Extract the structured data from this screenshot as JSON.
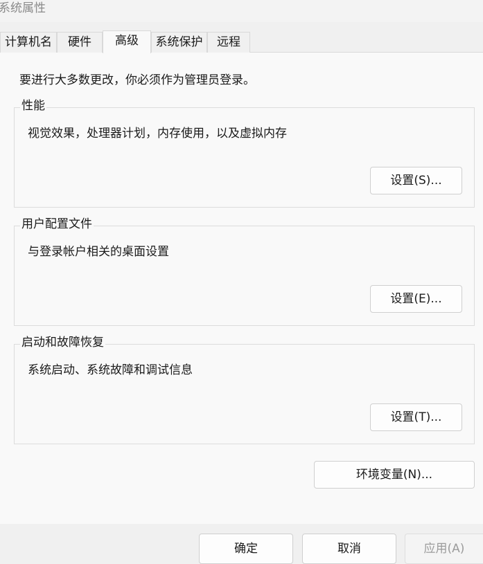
{
  "window": {
    "title": "系统属性"
  },
  "tabs": [
    {
      "label": "计算机名",
      "active": false
    },
    {
      "label": "硬件",
      "active": false
    },
    {
      "label": "高级",
      "active": true
    },
    {
      "label": "系统保护",
      "active": false
    },
    {
      "label": "远程",
      "active": false
    }
  ],
  "notice": "要进行大多数更改，你必须作为管理员登录。",
  "groups": {
    "performance": {
      "title": "性能",
      "description": "视觉效果，处理器计划，内存使用，以及虚拟内存",
      "button": "设置(S)..."
    },
    "user_profiles": {
      "title": "用户配置文件",
      "description": "与登录帐户相关的桌面设置",
      "button": "设置(E)..."
    },
    "startup_recovery": {
      "title": "启动和故障恢复",
      "description": "系统启动、系统故障和调试信息",
      "button": "设置(T)..."
    }
  },
  "env_button": "环境变量(N)...",
  "footer": {
    "ok": "确定",
    "cancel": "取消",
    "apply": "应用(A)",
    "apply_enabled": false
  }
}
